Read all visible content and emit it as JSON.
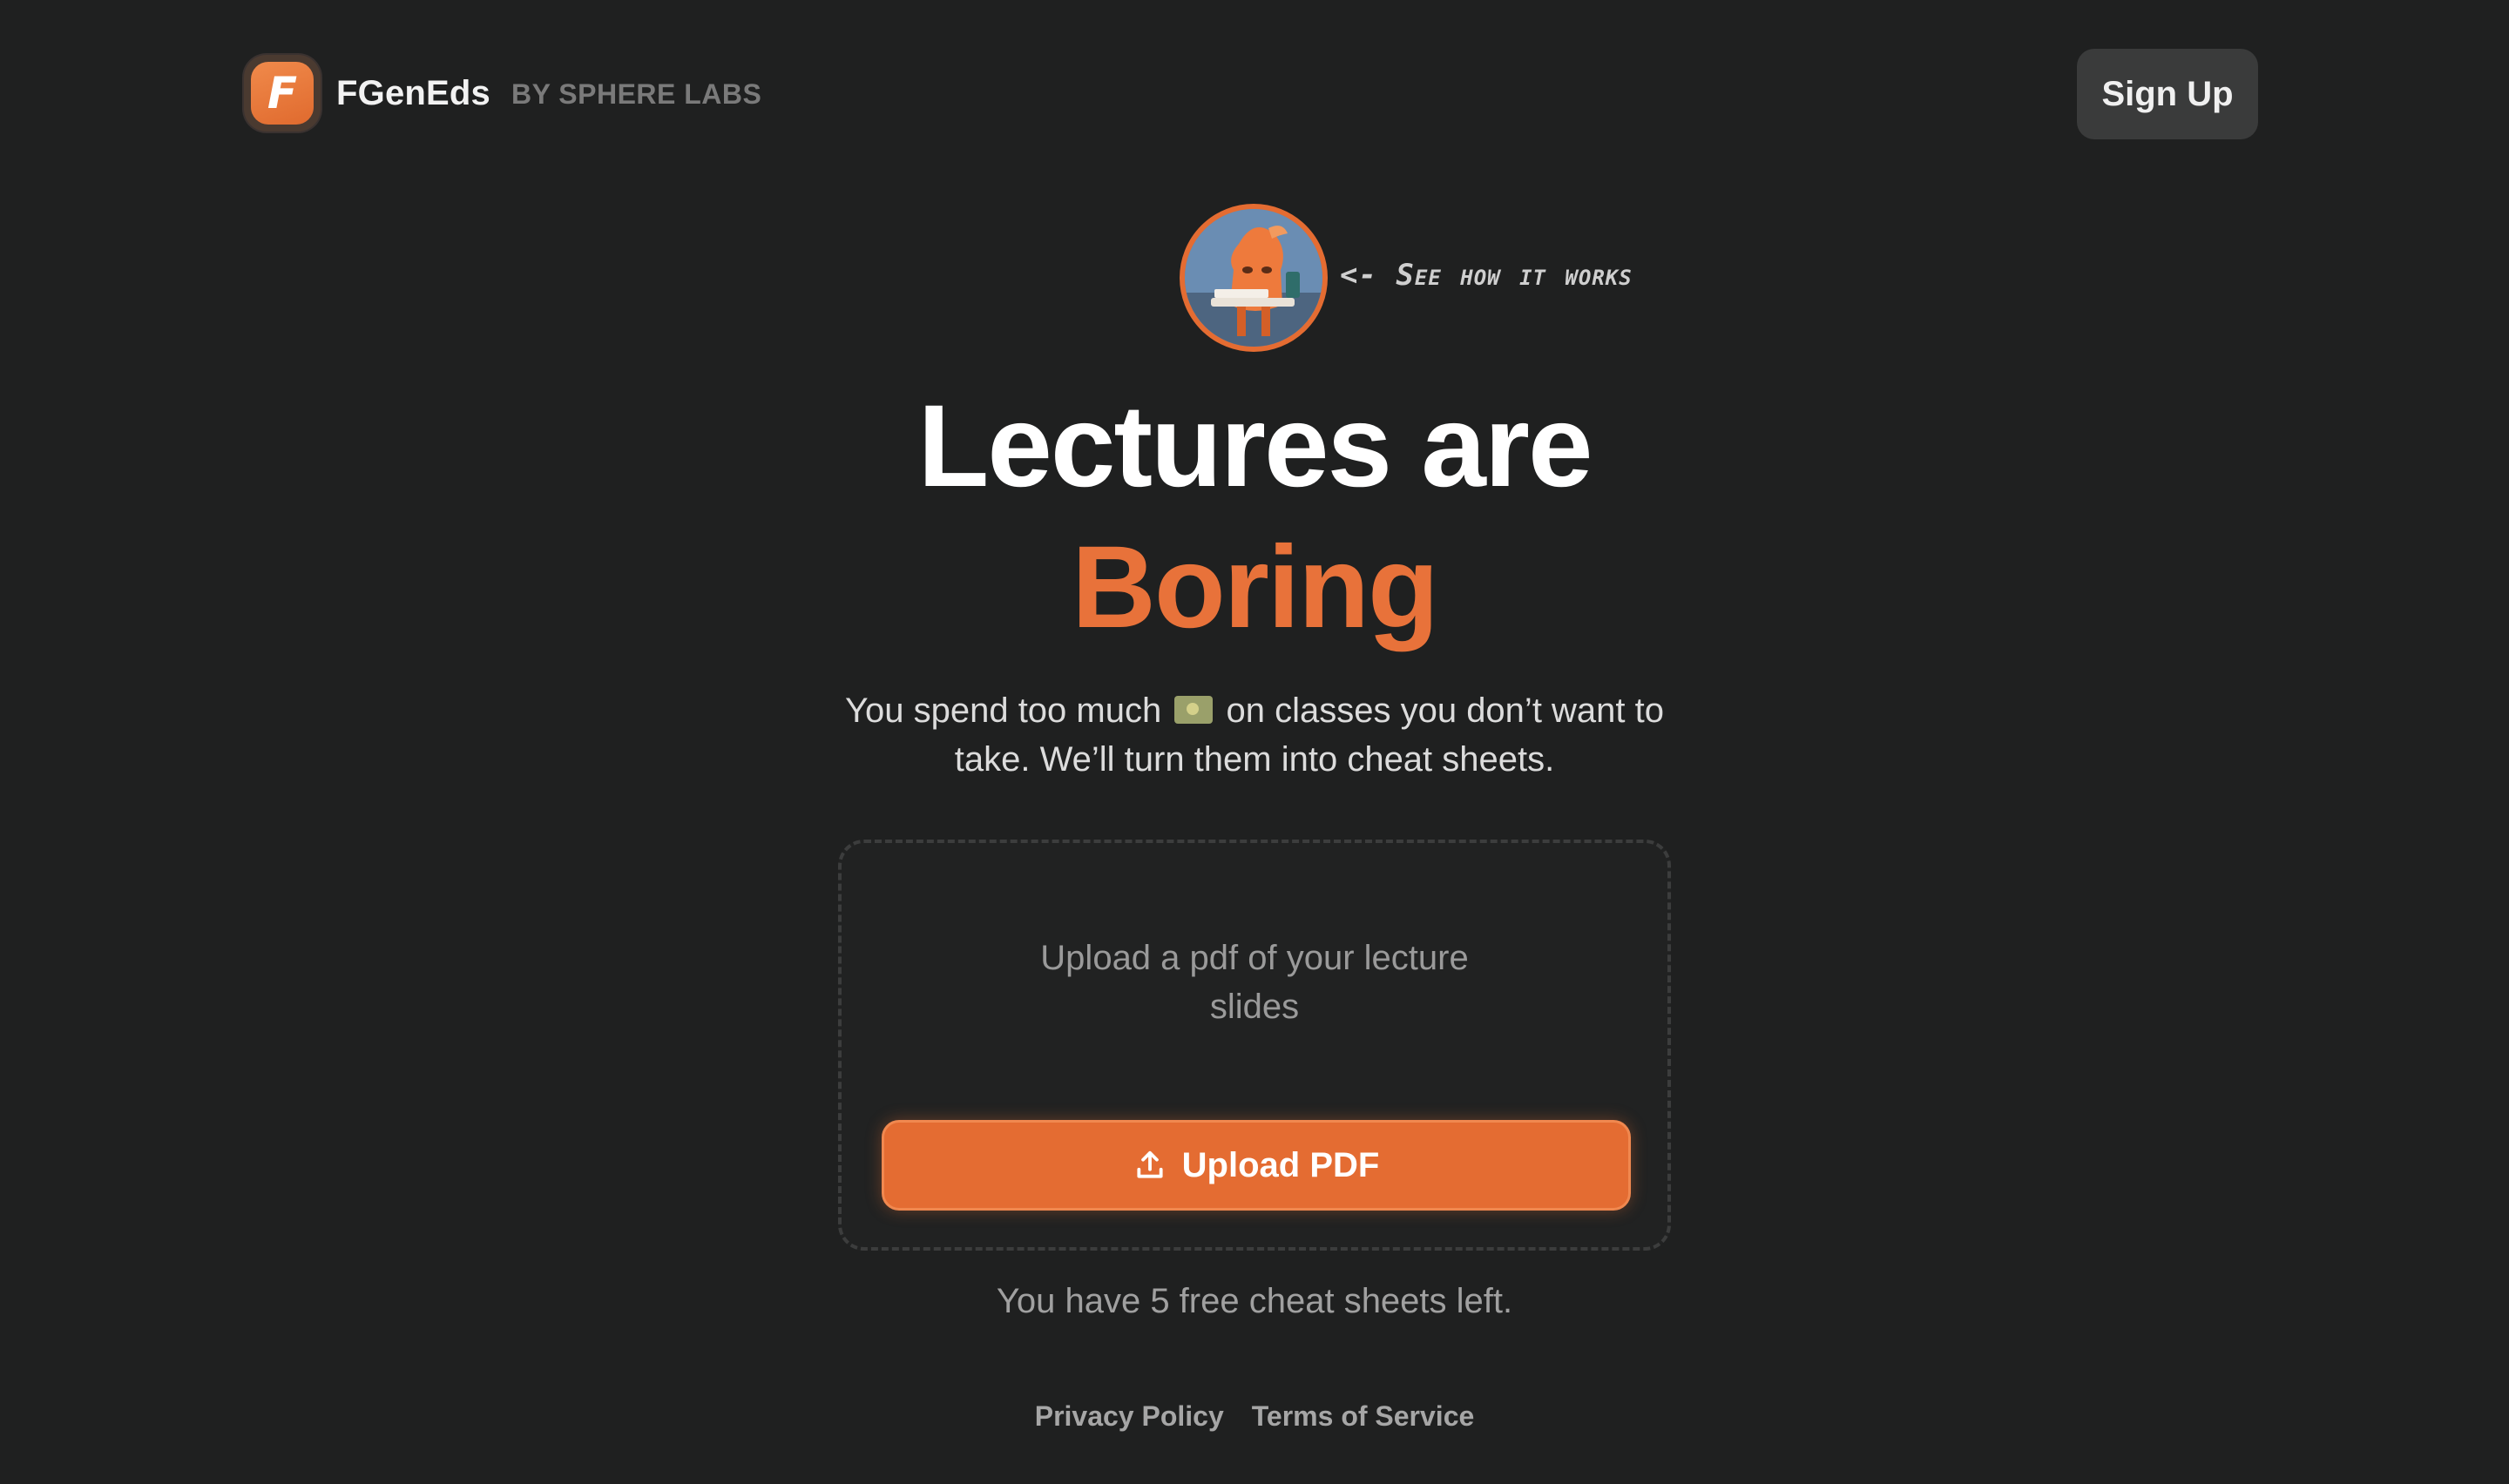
{
  "header": {
    "logo_letter": "F",
    "brand_name": "FGenEds",
    "brand_byline": "BY SPHERE LABS",
    "signup_label": "Sign Up"
  },
  "demo": {
    "hint": "<- See how it works",
    "avatar_alt": "mascot-image"
  },
  "hero": {
    "headline": "Lectures are",
    "headline_accent": "Boring",
    "subtitle_part1": "You spend too much",
    "subtitle_part2": "on classes you don’t want to take. We’ll turn them into cheat sheets."
  },
  "upload": {
    "prompt": "Upload a pdf of your lecture slides",
    "button_label": "Upload PDF",
    "icon": "upload-icon"
  },
  "status": {
    "credits_text": "You have 5 free cheat sheets left."
  },
  "footer": {
    "links": [
      "Privacy Policy",
      "Terms of Service"
    ]
  },
  "colors": {
    "background": "#1f2020",
    "accent": "#e46c32",
    "button_secondary": "#3a3b3b"
  }
}
